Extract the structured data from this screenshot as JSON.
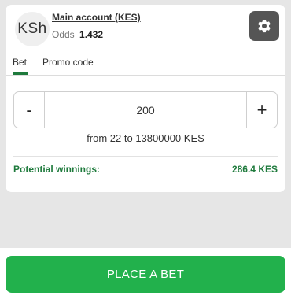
{
  "account": {
    "currency_symbol": "KSh",
    "name": "Main account (KES)",
    "odds_label": "Odds",
    "odds_value": "1.432"
  },
  "icons": {
    "settings": "gear-icon"
  },
  "tabs": [
    {
      "label": "Bet",
      "active": true
    },
    {
      "label": "Promo code",
      "active": false
    }
  ],
  "stake": {
    "minus_label": "-",
    "plus_label": "+",
    "value": "200",
    "range_text": "from 22 to 13800000 KES"
  },
  "winnings": {
    "label": "Potential winnings:",
    "value": "286.4 KES"
  },
  "actions": {
    "place_bet_label": "PLACE A BET"
  },
  "colors": {
    "accent_green": "#1e7a3c",
    "button_green": "#22b14c",
    "gear_button_bg": "#555555"
  }
}
